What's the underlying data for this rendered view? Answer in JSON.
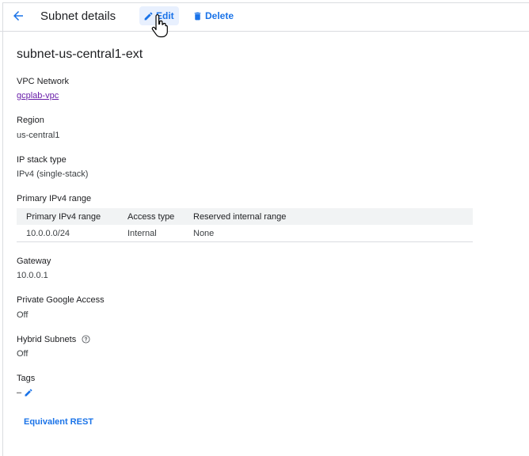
{
  "toolbar": {
    "title": "Subnet details",
    "edit_label": "Edit",
    "delete_label": "Delete"
  },
  "subnet": {
    "name": "subnet-us-central1-ext",
    "vpc_network_label": "VPC Network",
    "vpc_network_value": "gcplab-vpc",
    "region_label": "Region",
    "region_value": "us-central1",
    "ip_stack_label": "IP stack type",
    "ip_stack_value": "IPv4 (single-stack)",
    "primary_range_label": "Primary IPv4 range",
    "gateway_label": "Gateway",
    "gateway_value": "10.0.0.1",
    "private_google_access_label": "Private Google Access",
    "private_google_access_value": "Off",
    "hybrid_subnets_label": "Hybrid Subnets",
    "hybrid_subnets_value": "Off",
    "tags_label": "Tags",
    "tags_value": "–"
  },
  "ip_table": {
    "headers": [
      "Primary IPv4 range",
      "Access type",
      "Reserved internal range"
    ],
    "rows": [
      [
        "10.0.0.0/24",
        "Internal",
        "None"
      ]
    ]
  },
  "footer": {
    "equivalent_rest_label": "Equivalent REST"
  },
  "colors": {
    "accent": "#1a73e8",
    "visited_link": "#681da8",
    "divider": "#dadce0",
    "table_header_bg": "#f1f3f4"
  },
  "icons": [
    "back-arrow-icon",
    "pencil-icon",
    "trash-icon",
    "help-circle-icon",
    "hand-cursor-icon"
  ]
}
